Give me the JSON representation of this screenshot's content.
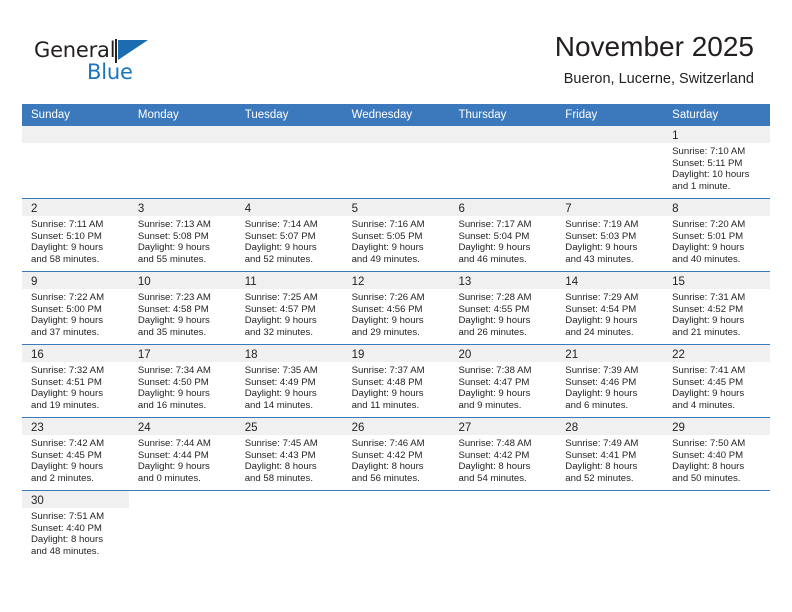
{
  "brand": {
    "name_top": "General",
    "name_bottom": "Blue",
    "accent_color": "#1b75bb",
    "flag_color": "#1b6cb0"
  },
  "header": {
    "title": "November 2025",
    "subtitle": "Bueron, Lucerne, Switzerland"
  },
  "theme": {
    "header_row_bg": "#3c78bc",
    "day_number_bg": "#f0f0f0",
    "text_color": "#231f20",
    "rule_color": "#3c78bc"
  },
  "weekdays": [
    "Sunday",
    "Monday",
    "Tuesday",
    "Wednesday",
    "Thursday",
    "Friday",
    "Saturday"
  ],
  "labels": {
    "sunrise": "Sunrise:",
    "sunset": "Sunset:",
    "daylight": "Daylight:"
  },
  "weeks": [
    [
      {
        "day": "",
        "sunrise": "",
        "sunset": "",
        "daylight_1": "",
        "daylight_2": "",
        "empty": true
      },
      {
        "day": "",
        "sunrise": "",
        "sunset": "",
        "daylight_1": "",
        "daylight_2": "",
        "empty": true
      },
      {
        "day": "",
        "sunrise": "",
        "sunset": "",
        "daylight_1": "",
        "daylight_2": "",
        "empty": true
      },
      {
        "day": "",
        "sunrise": "",
        "sunset": "",
        "daylight_1": "",
        "daylight_2": "",
        "empty": true
      },
      {
        "day": "",
        "sunrise": "",
        "sunset": "",
        "daylight_1": "",
        "daylight_2": "",
        "empty": true
      },
      {
        "day": "",
        "sunrise": "",
        "sunset": "",
        "daylight_1": "",
        "daylight_2": "",
        "empty": true
      },
      {
        "day": "1",
        "sunrise": "Sunrise: 7:10 AM",
        "sunset": "Sunset: 5:11 PM",
        "daylight_1": "Daylight: 10 hours",
        "daylight_2": "and 1 minute."
      }
    ],
    [
      {
        "day": "2",
        "sunrise": "Sunrise: 7:11 AM",
        "sunset": "Sunset: 5:10 PM",
        "daylight_1": "Daylight: 9 hours",
        "daylight_2": "and 58 minutes."
      },
      {
        "day": "3",
        "sunrise": "Sunrise: 7:13 AM",
        "sunset": "Sunset: 5:08 PM",
        "daylight_1": "Daylight: 9 hours",
        "daylight_2": "and 55 minutes."
      },
      {
        "day": "4",
        "sunrise": "Sunrise: 7:14 AM",
        "sunset": "Sunset: 5:07 PM",
        "daylight_1": "Daylight: 9 hours",
        "daylight_2": "and 52 minutes."
      },
      {
        "day": "5",
        "sunrise": "Sunrise: 7:16 AM",
        "sunset": "Sunset: 5:05 PM",
        "daylight_1": "Daylight: 9 hours",
        "daylight_2": "and 49 minutes."
      },
      {
        "day": "6",
        "sunrise": "Sunrise: 7:17 AM",
        "sunset": "Sunset: 5:04 PM",
        "daylight_1": "Daylight: 9 hours",
        "daylight_2": "and 46 minutes."
      },
      {
        "day": "7",
        "sunrise": "Sunrise: 7:19 AM",
        "sunset": "Sunset: 5:03 PM",
        "daylight_1": "Daylight: 9 hours",
        "daylight_2": "and 43 minutes."
      },
      {
        "day": "8",
        "sunrise": "Sunrise: 7:20 AM",
        "sunset": "Sunset: 5:01 PM",
        "daylight_1": "Daylight: 9 hours",
        "daylight_2": "and 40 minutes."
      }
    ],
    [
      {
        "day": "9",
        "sunrise": "Sunrise: 7:22 AM",
        "sunset": "Sunset: 5:00 PM",
        "daylight_1": "Daylight: 9 hours",
        "daylight_2": "and 37 minutes."
      },
      {
        "day": "10",
        "sunrise": "Sunrise: 7:23 AM",
        "sunset": "Sunset: 4:58 PM",
        "daylight_1": "Daylight: 9 hours",
        "daylight_2": "and 35 minutes."
      },
      {
        "day": "11",
        "sunrise": "Sunrise: 7:25 AM",
        "sunset": "Sunset: 4:57 PM",
        "daylight_1": "Daylight: 9 hours",
        "daylight_2": "and 32 minutes."
      },
      {
        "day": "12",
        "sunrise": "Sunrise: 7:26 AM",
        "sunset": "Sunset: 4:56 PM",
        "daylight_1": "Daylight: 9 hours",
        "daylight_2": "and 29 minutes."
      },
      {
        "day": "13",
        "sunrise": "Sunrise: 7:28 AM",
        "sunset": "Sunset: 4:55 PM",
        "daylight_1": "Daylight: 9 hours",
        "daylight_2": "and 26 minutes."
      },
      {
        "day": "14",
        "sunrise": "Sunrise: 7:29 AM",
        "sunset": "Sunset: 4:54 PM",
        "daylight_1": "Daylight: 9 hours",
        "daylight_2": "and 24 minutes."
      },
      {
        "day": "15",
        "sunrise": "Sunrise: 7:31 AM",
        "sunset": "Sunset: 4:52 PM",
        "daylight_1": "Daylight: 9 hours",
        "daylight_2": "and 21 minutes."
      }
    ],
    [
      {
        "day": "16",
        "sunrise": "Sunrise: 7:32 AM",
        "sunset": "Sunset: 4:51 PM",
        "daylight_1": "Daylight: 9 hours",
        "daylight_2": "and 19 minutes."
      },
      {
        "day": "17",
        "sunrise": "Sunrise: 7:34 AM",
        "sunset": "Sunset: 4:50 PM",
        "daylight_1": "Daylight: 9 hours",
        "daylight_2": "and 16 minutes."
      },
      {
        "day": "18",
        "sunrise": "Sunrise: 7:35 AM",
        "sunset": "Sunset: 4:49 PM",
        "daylight_1": "Daylight: 9 hours",
        "daylight_2": "and 14 minutes."
      },
      {
        "day": "19",
        "sunrise": "Sunrise: 7:37 AM",
        "sunset": "Sunset: 4:48 PM",
        "daylight_1": "Daylight: 9 hours",
        "daylight_2": "and 11 minutes."
      },
      {
        "day": "20",
        "sunrise": "Sunrise: 7:38 AM",
        "sunset": "Sunset: 4:47 PM",
        "daylight_1": "Daylight: 9 hours",
        "daylight_2": "and 9 minutes."
      },
      {
        "day": "21",
        "sunrise": "Sunrise: 7:39 AM",
        "sunset": "Sunset: 4:46 PM",
        "daylight_1": "Daylight: 9 hours",
        "daylight_2": "and 6 minutes."
      },
      {
        "day": "22",
        "sunrise": "Sunrise: 7:41 AM",
        "sunset": "Sunset: 4:45 PM",
        "daylight_1": "Daylight: 9 hours",
        "daylight_2": "and 4 minutes."
      }
    ],
    [
      {
        "day": "23",
        "sunrise": "Sunrise: 7:42 AM",
        "sunset": "Sunset: 4:45 PM",
        "daylight_1": "Daylight: 9 hours",
        "daylight_2": "and 2 minutes."
      },
      {
        "day": "24",
        "sunrise": "Sunrise: 7:44 AM",
        "sunset": "Sunset: 4:44 PM",
        "daylight_1": "Daylight: 9 hours",
        "daylight_2": "and 0 minutes."
      },
      {
        "day": "25",
        "sunrise": "Sunrise: 7:45 AM",
        "sunset": "Sunset: 4:43 PM",
        "daylight_1": "Daylight: 8 hours",
        "daylight_2": "and 58 minutes."
      },
      {
        "day": "26",
        "sunrise": "Sunrise: 7:46 AM",
        "sunset": "Sunset: 4:42 PM",
        "daylight_1": "Daylight: 8 hours",
        "daylight_2": "and 56 minutes."
      },
      {
        "day": "27",
        "sunrise": "Sunrise: 7:48 AM",
        "sunset": "Sunset: 4:42 PM",
        "daylight_1": "Daylight: 8 hours",
        "daylight_2": "and 54 minutes."
      },
      {
        "day": "28",
        "sunrise": "Sunrise: 7:49 AM",
        "sunset": "Sunset: 4:41 PM",
        "daylight_1": "Daylight: 8 hours",
        "daylight_2": "and 52 minutes."
      },
      {
        "day": "29",
        "sunrise": "Sunrise: 7:50 AM",
        "sunset": "Sunset: 4:40 PM",
        "daylight_1": "Daylight: 8 hours",
        "daylight_2": "and 50 minutes."
      }
    ],
    [
      {
        "day": "30",
        "sunrise": "Sunrise: 7:51 AM",
        "sunset": "Sunset: 4:40 PM",
        "daylight_1": "Daylight: 8 hours",
        "daylight_2": "and 48 minutes."
      },
      {
        "day": "",
        "sunrise": "",
        "sunset": "",
        "daylight_1": "",
        "daylight_2": "",
        "blank": true
      },
      {
        "day": "",
        "sunrise": "",
        "sunset": "",
        "daylight_1": "",
        "daylight_2": "",
        "blank": true
      },
      {
        "day": "",
        "sunrise": "",
        "sunset": "",
        "daylight_1": "",
        "daylight_2": "",
        "blank": true
      },
      {
        "day": "",
        "sunrise": "",
        "sunset": "",
        "daylight_1": "",
        "daylight_2": "",
        "blank": true
      },
      {
        "day": "",
        "sunrise": "",
        "sunset": "",
        "daylight_1": "",
        "daylight_2": "",
        "blank": true
      },
      {
        "day": "",
        "sunrise": "",
        "sunset": "",
        "daylight_1": "",
        "daylight_2": "",
        "blank": true
      }
    ]
  ]
}
